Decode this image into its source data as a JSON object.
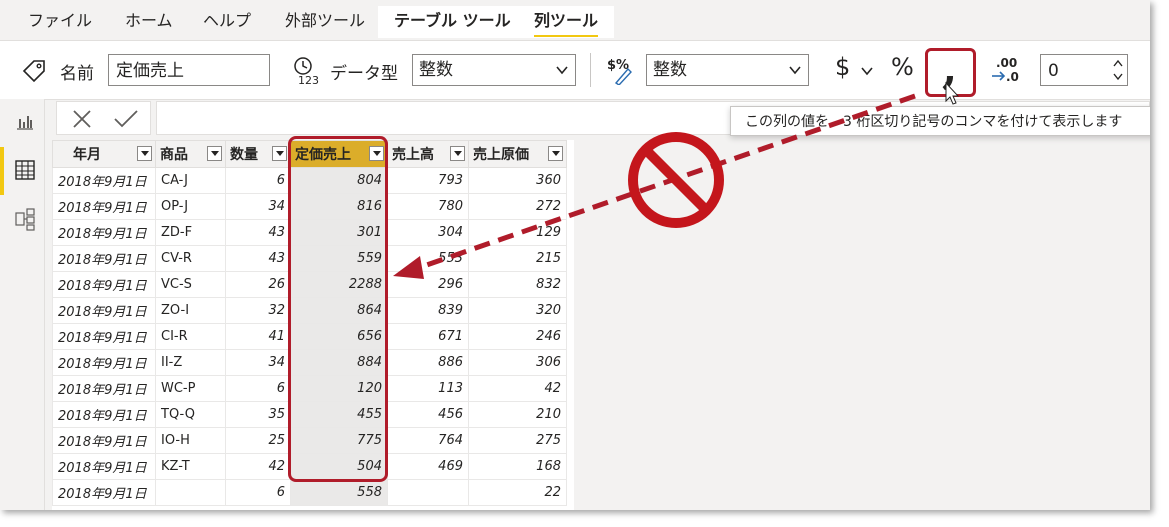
{
  "tabs": [
    "ファイル",
    "ホーム",
    "ヘルプ",
    "外部ツール",
    "テーブル ツール",
    "列ツール"
  ],
  "ribbon": {
    "name_label": "名前",
    "name_value": "定価売上",
    "datatype_label": "データ型",
    "datatype_value": "整数",
    "format_value": "整数",
    "currency_symbol": "$",
    "percent_symbol": "%",
    "comma_symbol": ",",
    "decimal_icon_text": ".00",
    "decimal_value": "0"
  },
  "tooltip": "この列の値を、3 桁区切り記号のコンマを付けて表示します",
  "table": {
    "columns": [
      "年月",
      "商品",
      "数量",
      "定価売上",
      "売上高",
      "売上原価"
    ],
    "rows": [
      [
        "2018年9月1日",
        "CA-J",
        "6",
        "804",
        "793",
        "360"
      ],
      [
        "2018年9月1日",
        "OP-J",
        "34",
        "816",
        "780",
        "272"
      ],
      [
        "2018年9月1日",
        "ZD-F",
        "43",
        "301",
        "304",
        "129"
      ],
      [
        "2018年9月1日",
        "CV-R",
        "43",
        "559",
        "553",
        "215"
      ],
      [
        "2018年9月1日",
        "VC-S",
        "26",
        "2288",
        "296",
        "832"
      ],
      [
        "2018年9月1日",
        "ZO-I",
        "32",
        "864",
        "839",
        "320"
      ],
      [
        "2018年9月1日",
        "CI-R",
        "41",
        "656",
        "671",
        "246"
      ],
      [
        "2018年9月1日",
        "II-Z",
        "34",
        "884",
        "886",
        "306"
      ],
      [
        "2018年9月1日",
        "WC-P",
        "6",
        "120",
        "113",
        "42"
      ],
      [
        "2018年9月1日",
        "TQ-Q",
        "35",
        "455",
        "456",
        "210"
      ],
      [
        "2018年9月1日",
        "IO-H",
        "25",
        "775",
        "764",
        "275"
      ],
      [
        "2018年9月1日",
        "KZ-T",
        "42",
        "504",
        "469",
        "168"
      ],
      [
        "2018年9月1日",
        "",
        "6",
        "558",
        "",
        "22"
      ]
    ]
  },
  "colors": {
    "accent": "#f2c811",
    "highlight_header": "#dbad2a",
    "annotation_red": "#b01c2a"
  }
}
